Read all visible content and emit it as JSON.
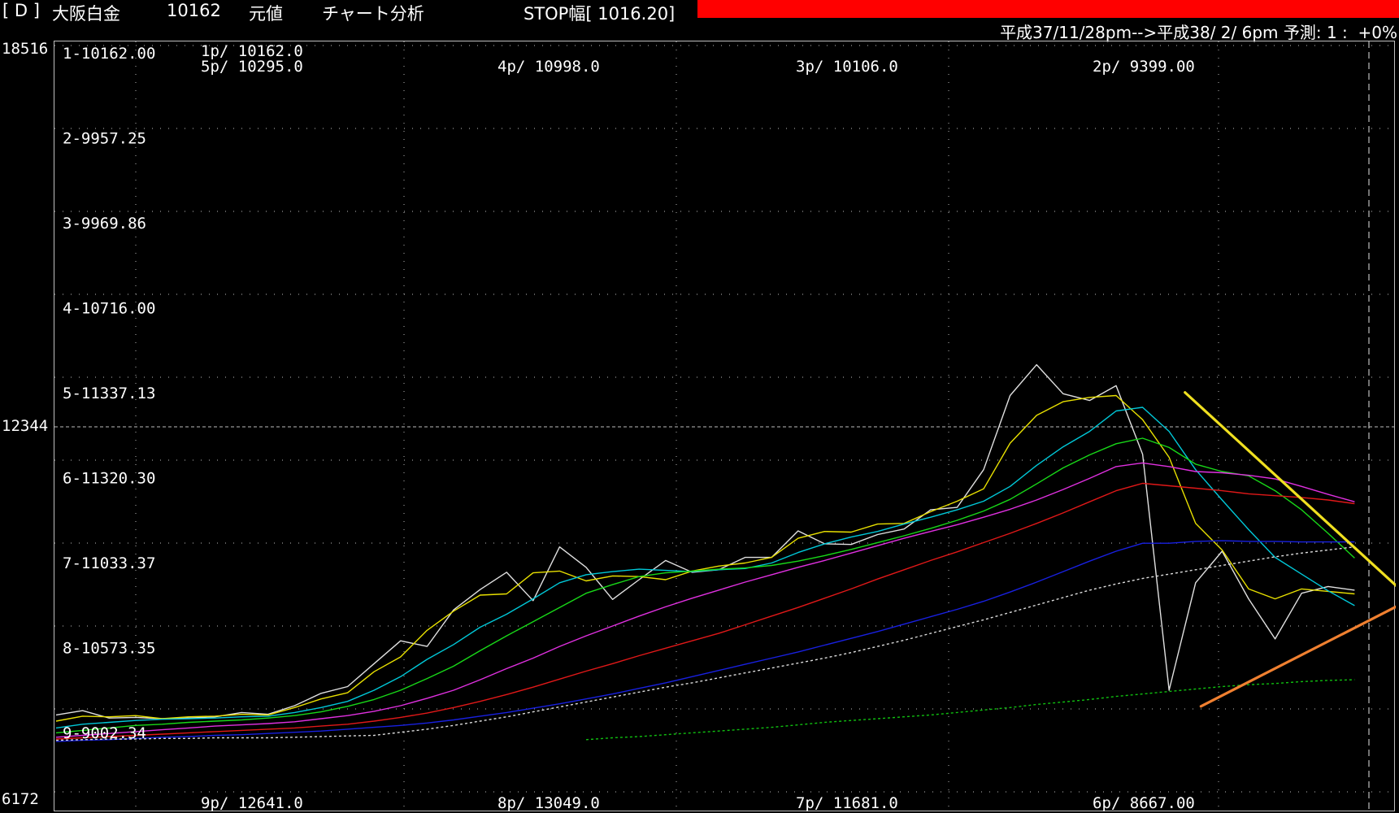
{
  "header": {
    "symbol_bracket": "[ D ]",
    "instrument": "大阪白金",
    "price": "10162",
    "price_type": "元値",
    "mode": "チャート分析",
    "stop_width": "STOP幅[ 1016.20]",
    "stop_bar_color": "#ff0000",
    "forecast": "平成37/11/28pm-->平成38/ 2/ 6pm 予測: 1 :  +0%"
  },
  "yaxis": {
    "max": "18516",
    "mid": "12344",
    "min": "6172"
  },
  "chart_data": {
    "type": "line",
    "ylim": [
      6172,
      18516
    ],
    "x_count": 50,
    "levels": [
      {
        "label": "1-10162.00",
        "row": 1
      },
      {
        "label": "2-9957.25",
        "row": 2
      },
      {
        "label": "3-9969.86",
        "row": 3
      },
      {
        "label": "4-10716.00",
        "row": 4
      },
      {
        "label": "5-11337.13",
        "row": 5
      },
      {
        "label": "6-11320.30",
        "row": 6
      },
      {
        "label": "7-11033.37",
        "row": 7
      },
      {
        "label": "8-10573.35",
        "row": 8
      },
      {
        "label": "9-9002.34",
        "row": 9
      }
    ],
    "top_annotations": [
      {
        "text": "1p/ 10162.0",
        "col": 0
      },
      {
        "text": "5p/ 10295.0",
        "col": 0
      },
      {
        "text": "4p/ 10998.0",
        "col": 1
      },
      {
        "text": "3p/ 10106.0",
        "col": 2
      },
      {
        "text": "2p/ 9399.00",
        "col": 3
      }
    ],
    "bottom_annotations": [
      {
        "text": "9p/ 12641.0",
        "col": 0
      },
      {
        "text": "8p/ 13049.0",
        "col": 1
      },
      {
        "text": "7p/ 11681.0",
        "col": 2
      },
      {
        "text": "6p/ 8667.00",
        "col": 3
      }
    ],
    "series": [
      {
        "color": "#e0e0e0",
        "style": "solid",
        "start": 0,
        "values": [
          7680,
          7750,
          7630,
          7640,
          7620,
          7630,
          7650,
          7720,
          7690,
          7830,
          8030,
          8140,
          8510,
          8880,
          8790,
          9380,
          9710,
          9990,
          9530,
          10400,
          10070,
          9550,
          9870,
          10180,
          9990,
          10030,
          10230,
          10230,
          10660,
          10450,
          10440,
          10600,
          10690,
          11000,
          11040,
          11650,
          12850,
          13350,
          12880,
          12770,
          13010,
          11900,
          8080,
          9820,
          10330,
          9560,
          8910,
          9650,
          9760,
          9700
        ]
      },
      {
        "color": "#e8e000",
        "style": "solid",
        "start": 0,
        "values": [
          7580,
          7660,
          7650,
          7670,
          7620,
          7650,
          7660,
          7690,
          7680,
          7800,
          7940,
          8040,
          8380,
          8620,
          9050,
          9360,
          9620,
          9640,
          9980,
          10010,
          9850,
          9930,
          9920,
          9870,
          10010,
          10090,
          10140,
          10230,
          10540,
          10650,
          10640,
          10770,
          10780,
          10970,
          11140,
          11340,
          12080,
          12530,
          12750,
          12820,
          12850,
          12460,
          11850,
          10780,
          10350,
          9720,
          9560,
          9720,
          9680,
          9640
        ]
      },
      {
        "color": "#00c8d8",
        "style": "solid",
        "start": 0,
        "values": [
          7470,
          7530,
          7560,
          7590,
          7610,
          7620,
          7630,
          7650,
          7660,
          7720,
          7800,
          7900,
          8080,
          8300,
          8580,
          8820,
          9100,
          9310,
          9560,
          9820,
          9950,
          10000,
          10040,
          10020,
          10000,
          10030,
          10050,
          10140,
          10310,
          10450,
          10560,
          10650,
          10770,
          10880,
          11000,
          11140,
          11380,
          11720,
          12020,
          12270,
          12600,
          12660,
          12270,
          11650,
          11160,
          10680,
          10230,
          9960,
          9690,
          9450
        ]
      },
      {
        "color": "#18d818",
        "style": "solid",
        "start": 0,
        "values": [
          7390,
          7430,
          7470,
          7510,
          7530,
          7560,
          7580,
          7600,
          7630,
          7670,
          7730,
          7820,
          7930,
          8080,
          8270,
          8470,
          8720,
          8960,
          9190,
          9420,
          9650,
          9790,
          9920,
          9980,
          10010,
          10040,
          10060,
          10100,
          10170,
          10260,
          10360,
          10470,
          10580,
          10700,
          10830,
          10980,
          11170,
          11420,
          11680,
          11890,
          12070,
          12160,
          12010,
          11740,
          11620,
          11550,
          11310,
          11000,
          10620,
          10220
        ]
      },
      {
        "color": "#e030e0",
        "style": "solid",
        "start": 0,
        "values": [
          7320,
          7350,
          7380,
          7410,
          7440,
          7470,
          7500,
          7520,
          7540,
          7570,
          7620,
          7670,
          7740,
          7830,
          7950,
          8080,
          8250,
          8430,
          8600,
          8790,
          8960,
          9120,
          9280,
          9430,
          9570,
          9700,
          9830,
          9950,
          10070,
          10180,
          10300,
          10420,
          10540,
          10650,
          10760,
          10880,
          11010,
          11160,
          11330,
          11510,
          11700,
          11760,
          11700,
          11620,
          11600,
          11560,
          11500,
          11380,
          11250,
          11130
        ]
      },
      {
        "color": "#e01818",
        "style": "solid",
        "start": 0,
        "values": [
          7290,
          7310,
          7330,
          7350,
          7370,
          7390,
          7410,
          7430,
          7450,
          7470,
          7500,
          7530,
          7580,
          7640,
          7710,
          7800,
          7900,
          8010,
          8130,
          8260,
          8390,
          8510,
          8640,
          8760,
          8880,
          9000,
          9140,
          9280,
          9420,
          9570,
          9720,
          9880,
          10030,
          10180,
          10320,
          10470,
          10620,
          10780,
          10950,
          11130,
          11310,
          11430,
          11390,
          11350,
          11310,
          11260,
          11230,
          11200,
          11160,
          11100
        ]
      },
      {
        "color": "#1820e0",
        "style": "solid",
        "start": 0,
        "values": [
          7250,
          7270,
          7280,
          7300,
          7320,
          7330,
          7350,
          7360,
          7380,
          7400,
          7420,
          7450,
          7480,
          7510,
          7550,
          7600,
          7660,
          7720,
          7790,
          7860,
          7940,
          8020,
          8110,
          8200,
          8300,
          8400,
          8500,
          8600,
          8700,
          8810,
          8920,
          9030,
          9150,
          9270,
          9390,
          9520,
          9670,
          9830,
          10000,
          10170,
          10330,
          10460,
          10460,
          10490,
          10500,
          10490,
          10490,
          10480,
          10480,
          10480
        ]
      },
      {
        "color": "#dcdcdc",
        "style": "dashed",
        "start": 0,
        "values": [
          7270,
          7280,
          7290,
          7290,
          7300,
          7300,
          7310,
          7310,
          7310,
          7320,
          7330,
          7340,
          7350,
          7400,
          7450,
          7510,
          7580,
          7650,
          7730,
          7810,
          7890,
          7970,
          8050,
          8130,
          8200,
          8280,
          8360,
          8440,
          8520,
          8600,
          8690,
          8790,
          8890,
          9000,
          9110,
          9220,
          9340,
          9460,
          9580,
          9700,
          9800,
          9890,
          9960,
          10030,
          10100,
          10170,
          10240,
          10300,
          10350,
          10400
        ]
      },
      {
        "color": "#10c010",
        "style": "dashed",
        "start": 20,
        "values": [
          7280,
          7310,
          7330,
          7360,
          7390,
          7420,
          7450,
          7480,
          7520,
          7560,
          7590,
          7620,
          7650,
          7680,
          7720,
          7760,
          7800,
          7850,
          7890,
          7930,
          7980,
          8020,
          8060,
          8100,
          8140,
          8170,
          8190,
          8220,
          8240,
          8250
        ]
      }
    ],
    "trendlines": [
      {
        "color": "#f0e020",
        "from": [
          42.6,
          12900
        ],
        "to": [
          50.6,
          9760
        ]
      },
      {
        "color": "#f08030",
        "from": [
          43.2,
          7820
        ],
        "to": [
          50.6,
          9440
        ]
      }
    ]
  }
}
